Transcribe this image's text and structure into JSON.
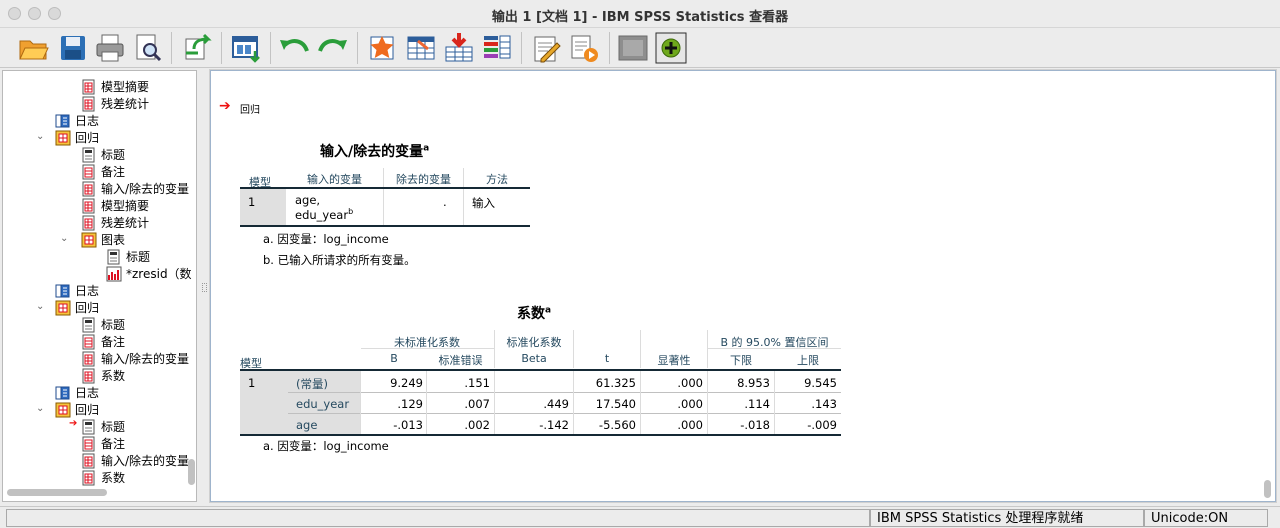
{
  "window": {
    "title": "输出 1 [文档 1] - IBM SPSS Statistics 查看器"
  },
  "toolbar": {
    "buttons": [
      "open-icon",
      "save-icon",
      "print-icon",
      "print-preview-icon",
      "export-icon",
      "recall-dialog-icon",
      "undo-icon",
      "redo-icon",
      "goto-case-icon",
      "goto-variable-icon",
      "insert-cases-icon",
      "variables-icon",
      "designate-window-icon",
      "run-script-icon",
      "hide-icon",
      "promote-icon"
    ]
  },
  "outline": {
    "items": [
      {
        "label": "模型摘要",
        "icon": "table-icon"
      },
      {
        "label": "残差统计",
        "icon": "table-icon"
      },
      {
        "label": "日志",
        "icon": "log-icon"
      },
      {
        "label": "回归",
        "icon": "procedure-icon"
      },
      {
        "label": "标题",
        "icon": "title-icon"
      },
      {
        "label": "备注",
        "icon": "notes-icon"
      },
      {
        "label": "输入/除去的变量",
        "icon": "table-icon"
      },
      {
        "label": "模型摘要",
        "icon": "table-icon"
      },
      {
        "label": "残差统计",
        "icon": "table-icon"
      },
      {
        "label": "图表",
        "icon": "procedure-icon"
      },
      {
        "label": "标题",
        "icon": "title-icon"
      },
      {
        "label": "*zresid（数",
        "icon": "chart-icon"
      },
      {
        "label": "日志",
        "icon": "log-icon"
      },
      {
        "label": "回归",
        "icon": "procedure-icon"
      },
      {
        "label": "标题",
        "icon": "title-icon"
      },
      {
        "label": "备注",
        "icon": "notes-icon"
      },
      {
        "label": "输入/除去的变量",
        "icon": "table-icon"
      },
      {
        "label": "系数",
        "icon": "table-icon"
      },
      {
        "label": "日志",
        "icon": "log-icon"
      },
      {
        "label": "回归",
        "icon": "procedure-icon"
      },
      {
        "label": "标题",
        "icon": "title-icon"
      },
      {
        "label": "备注",
        "icon": "notes-icon"
      },
      {
        "label": "输入/除去的变量",
        "icon": "table-icon"
      },
      {
        "label": "系数",
        "icon": "table-icon"
      }
    ]
  },
  "content": {
    "section_title": "回归",
    "table1": {
      "title": "输入/除去的变量",
      "title_sup": "a",
      "headers": [
        "模型",
        "输入的变量",
        "除去的变量",
        "方法"
      ],
      "row": {
        "model": "1",
        "entered_line1": "age,",
        "entered_line2": "edu_year",
        "entered_sup": "b",
        "removed": ".",
        "method": "输入"
      },
      "notes": [
        "a. 因变量：log_income",
        "b. 已输入所请求的所有变量。"
      ]
    },
    "table2": {
      "title": "系数",
      "title_sup": "a",
      "group_headers": [
        "未标准化系数",
        "标准化系数",
        "B 的 95.0% 置信区间"
      ],
      "headers": [
        "模型",
        "B",
        "标准错误",
        "Beta",
        "t",
        "显著性",
        "下限",
        "上限"
      ],
      "model": "1",
      "rows": [
        {
          "label": "(常量)",
          "b": "9.249",
          "se": ".151",
          "beta": "",
          "t": "61.325",
          "sig": ".000",
          "lower": "8.953",
          "upper": "9.545"
        },
        {
          "label": "edu_year",
          "b": ".129",
          "se": ".007",
          "beta": ".449",
          "t": "17.540",
          "sig": ".000",
          "lower": ".114",
          "upper": ".143"
        },
        {
          "label": "age",
          "b": "-.013",
          "se": ".002",
          "beta": "-.142",
          "t": "-5.560",
          "sig": ".000",
          "lower": "-.018",
          "upper": "-.009"
        }
      ],
      "note": "a. 因变量：log_income"
    }
  },
  "status": {
    "main": "IBM SPSS Statistics 处理程序就绪",
    "unicode": "Unicode:ON"
  }
}
